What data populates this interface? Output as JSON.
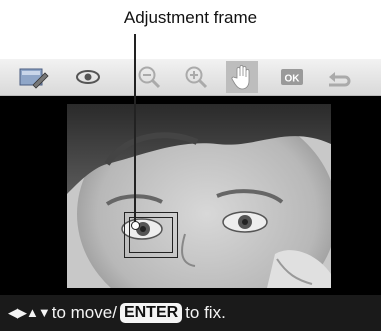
{
  "callout": {
    "label": "Adjustment frame"
  },
  "toolbar": {
    "tools": [
      {
        "name": "image-edit-icon",
        "active": false
      },
      {
        "name": "eye-icon",
        "active": false
      },
      {
        "name": "zoom-out-icon",
        "active": false
      },
      {
        "name": "zoom-in-icon",
        "active": false
      },
      {
        "name": "hand-icon",
        "active": true
      },
      {
        "name": "ok-icon",
        "label": "OK",
        "active": false
      },
      {
        "name": "return-icon",
        "active": false
      }
    ]
  },
  "status": {
    "arrows": "◀▶▲▼",
    "text_before": "to move/",
    "enter_key": "ENTER",
    "text_after": " to fix."
  },
  "colors": {
    "toolbar_bg": "#e0e0e0",
    "screen_bg": "#000000",
    "active_tool": "#bdbdbd"
  }
}
